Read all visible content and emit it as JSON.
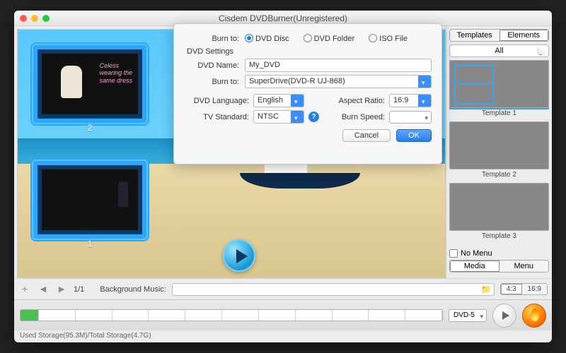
{
  "window": {
    "title": "Cisdem DVDBurner(Unregistered)"
  },
  "preview": {
    "slot1_num": "2",
    "slot2_num": "1",
    "overlay_text": "Celess\nwearing\nthe\nsame\ndress"
  },
  "sidebar": {
    "tabs": {
      "templates": "Templates",
      "elements": "Elements"
    },
    "filter": "All",
    "templates": [
      {
        "caption": "Template 1"
      },
      {
        "caption": "Template 2"
      },
      {
        "caption": "Template 3"
      }
    ],
    "no_menu_label": "No Menu",
    "bottom_tabs": {
      "media": "Media",
      "menu": "Menu"
    }
  },
  "controls": {
    "page": "1/1",
    "music_label": "Background Music:",
    "music_value": "",
    "ratio": {
      "a": "4:3",
      "b": "16:9"
    }
  },
  "bottom": {
    "disc_type": "DVD-5",
    "storage": "Used Storage(95.3M)/Total Storage(4.7G)"
  },
  "dialog": {
    "burn_to_label": "Burn to:",
    "opt_disc": "DVD Disc",
    "opt_folder": "DVD Folder",
    "opt_iso": "ISO File",
    "settings_label": "DVD Settings",
    "dvd_name_label": "DVD Name:",
    "dvd_name_value": "My_DVD",
    "drive_label": "Burn to:",
    "drive_value": "SuperDrive(DVD-R   UJ-868)",
    "lang_label": "DVD Language:",
    "lang_value": "English",
    "aspect_label": "Aspect Ratio:",
    "aspect_value": "16:9",
    "tv_label": "TV Standard:",
    "tv_value": "NTSC",
    "speed_label": "Burn Speed:",
    "speed_value": "",
    "cancel": "Cancel",
    "ok": "OK"
  }
}
